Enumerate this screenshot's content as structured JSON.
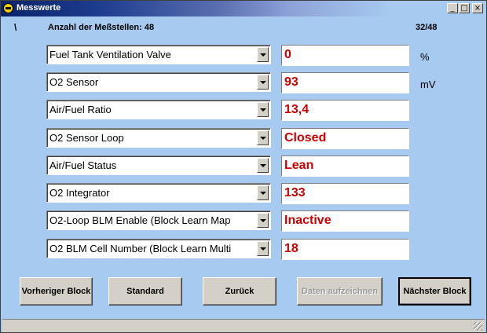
{
  "window": {
    "title": "Messwerte",
    "controls": {
      "minimize": "_",
      "maximize": "□",
      "close": "×"
    }
  },
  "header": {
    "spinner": "\\",
    "count_label": "Anzahl der Meßstellen: 48",
    "page_counter": "32/48"
  },
  "rows": [
    {
      "name": "Fuel Tank Ventilation Valve",
      "value": "0",
      "unit": "%"
    },
    {
      "name": "O2 Sensor",
      "value": "93",
      "unit": "mV"
    },
    {
      "name": "Air/Fuel Ratio",
      "value": "13,4",
      "unit": ""
    },
    {
      "name": "O2 Sensor Loop",
      "value": "Closed",
      "unit": ""
    },
    {
      "name": "Air/Fuel Status",
      "value": "Lean",
      "unit": ""
    },
    {
      "name": "O2 Integrator",
      "value": "133",
      "unit": ""
    },
    {
      "name": "O2-Loop BLM Enable (Block Learn Map",
      "value": "Inactive",
      "unit": ""
    },
    {
      "name": "O2 BLM Cell Number (Block Learn Multi",
      "value": "18",
      "unit": ""
    }
  ],
  "buttons": {
    "previous": "Vorheriger Block",
    "standard": "Standard",
    "back": "Zurück",
    "record": "Daten aufzeichnen",
    "next": "Nächster Block"
  },
  "colors": {
    "window_bg": "#a6caf0",
    "value_text": "#cc0000",
    "title_bar": "#0a246a"
  }
}
